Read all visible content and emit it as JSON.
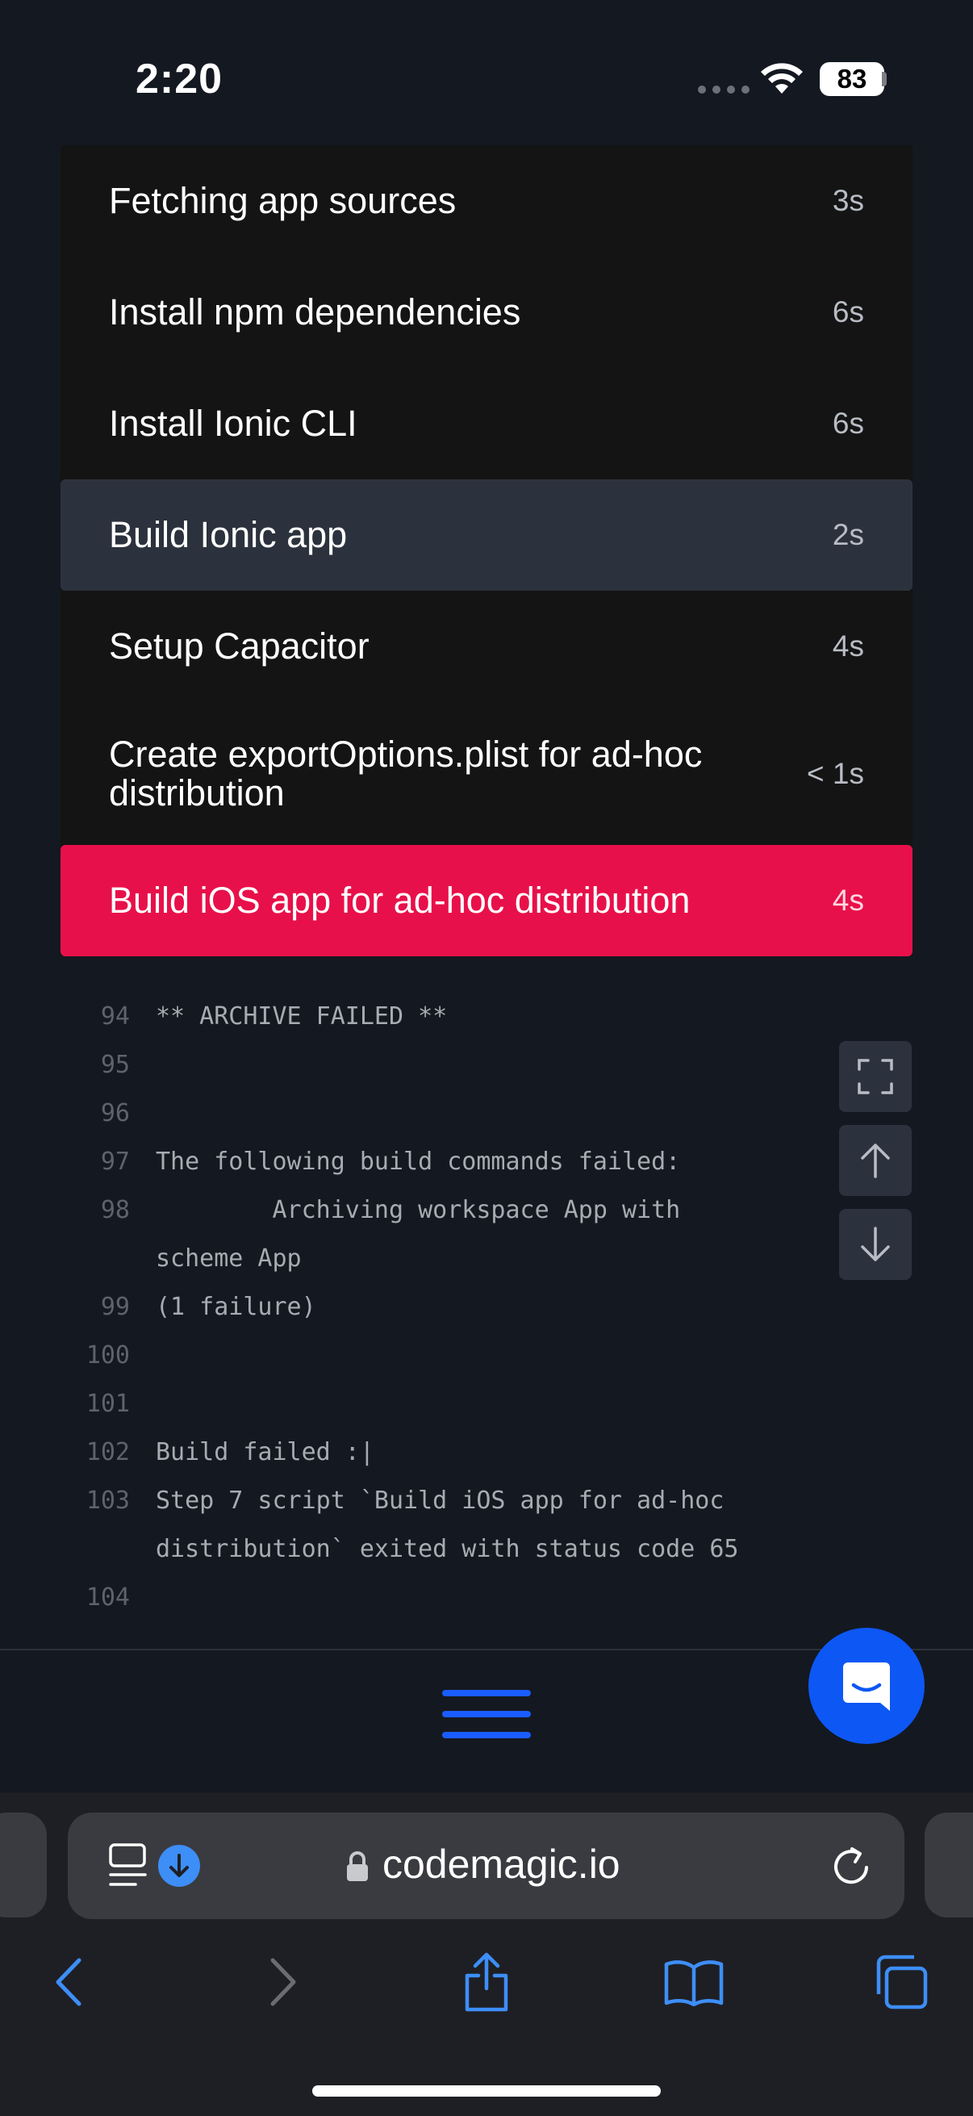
{
  "status_bar": {
    "time": "2:20",
    "battery": "83"
  },
  "steps": [
    {
      "title": "Fetching app sources",
      "duration": "3s",
      "state": "done"
    },
    {
      "title": "Install npm dependencies",
      "duration": "6s",
      "state": "done"
    },
    {
      "title": "Install Ionic CLI",
      "duration": "6s",
      "state": "done"
    },
    {
      "title": "Build Ionic app",
      "duration": "2s",
      "state": "active"
    },
    {
      "title": "Setup Capacitor",
      "duration": "4s",
      "state": "done"
    },
    {
      "title": "Create exportOptions.plist for ad-hoc distribution",
      "duration": "< 1s",
      "state": "done"
    },
    {
      "title": "Build iOS app for ad-hoc distribution",
      "duration": "4s",
      "state": "failed"
    }
  ],
  "log": [
    {
      "n": "94",
      "t": "** ARCHIVE FAILED **"
    },
    {
      "n": "95",
      "t": ""
    },
    {
      "n": "96",
      "t": ""
    },
    {
      "n": "97",
      "t": "The following build commands failed:"
    },
    {
      "n": "98",
      "t": "        Archiving workspace App with scheme App"
    },
    {
      "n": "99",
      "t": "(1 failure)"
    },
    {
      "n": "100",
      "t": ""
    },
    {
      "n": "101",
      "t": ""
    },
    {
      "n": "102",
      "t": "Build failed :|"
    },
    {
      "n": "103",
      "t": "Step 7 script `Build iOS app for ad-hoc distribution` exited with status code 65"
    },
    {
      "n": "104",
      "t": ""
    }
  ],
  "browser": {
    "url": "codemagic.io"
  },
  "colors": {
    "failed": "#e8104a",
    "active": "#2c323d",
    "accent": "#1a5cff",
    "safari_blue": "#3d8ef7"
  }
}
